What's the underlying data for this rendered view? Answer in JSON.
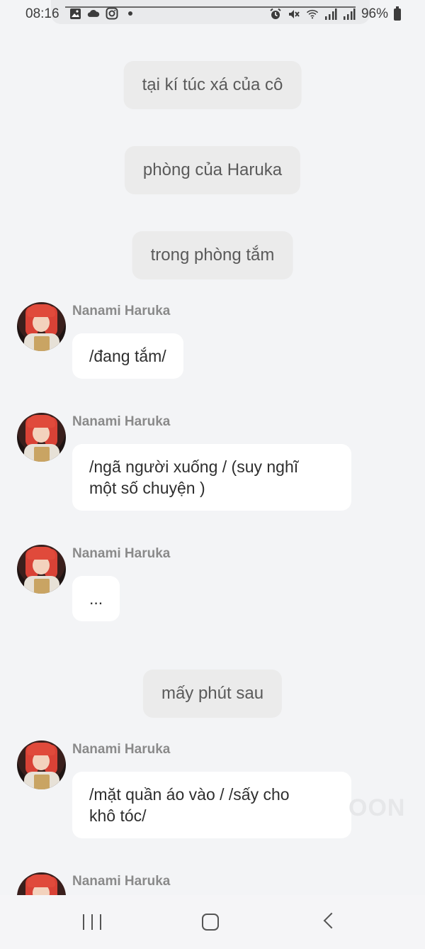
{
  "status_bar": {
    "time": "08:16",
    "battery": "96%",
    "left_icons": [
      "image-icon",
      "cloud-icon",
      "instagram-icon",
      "dot-icon"
    ],
    "right_icons": [
      "alarm-icon",
      "mute-icon",
      "wifi-icon",
      "signal-icon",
      "signal-icon"
    ]
  },
  "narrations": [
    "tại kí túc xá của cô",
    "phòng của Haruka",
    "trong phòng tắm",
    "mấy phút sau"
  ],
  "messages": [
    {
      "sender": "Nanami Haruka",
      "lines": [
        "/đang tắm/"
      ]
    },
    {
      "sender": "Nanami Haruka",
      "lines": [
        "/ngã người xuống / (suy nghĩ",
        "một số chuyện )"
      ]
    },
    {
      "sender": "Nanami Haruka",
      "lines": [
        "..."
      ]
    },
    {
      "sender": "Nanami Haruka",
      "lines": [
        "/mặt quần áo vào / /sấy cho",
        "khô tóc/"
      ]
    },
    {
      "sender": "Nanami Haruka",
      "lines": []
    }
  ],
  "watermark": "OON",
  "navbar": {
    "icons": [
      "recent-apps-icon",
      "home-icon",
      "back-icon"
    ]
  },
  "colors": {
    "background": "#f3f4f6",
    "narration_bg": "#ebebeb",
    "bubble_bg": "#ffffff",
    "sender_text": "#8a8a8a"
  }
}
